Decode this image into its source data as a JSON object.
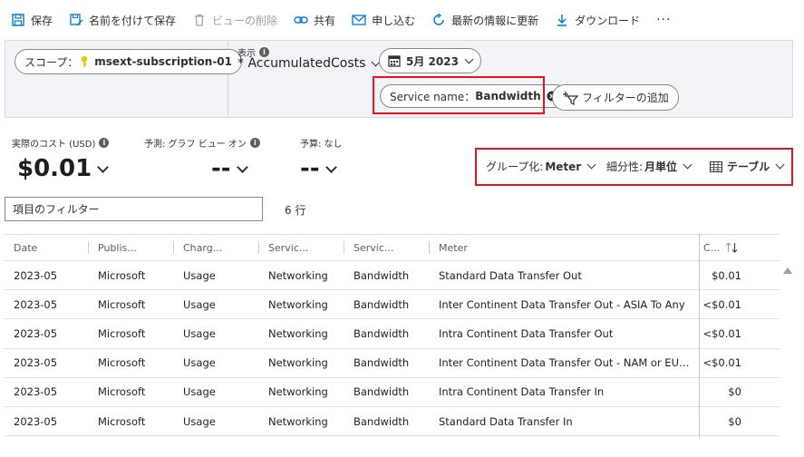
{
  "toolbar": {
    "save": "保存",
    "save_as": "名前を付けて保存",
    "delete_view": "ビューの削除",
    "share": "共有",
    "subscribe": "申し込む",
    "refresh": "最新の情報に更新",
    "download": "ダウンロード",
    "more": "···"
  },
  "filters": {
    "scope_label": "スコープ：",
    "scope_value": "msext-subscription-01",
    "view_label": "表示",
    "view_name": "* AccumulatedCosts",
    "date_range": "5月 2023",
    "service_filter_label": "Service name：",
    "service_filter_value": "Bandwidth",
    "add_filter": "フィルターの追加"
  },
  "kpis": {
    "actual_label": "実際のコスト (USD)",
    "actual_value": "$0.01",
    "forecast_label": "予測: グラフ ビュー オン",
    "forecast_value": "--",
    "budget_label": "予算: なし",
    "budget_value": "--"
  },
  "grouping": {
    "group_label": "グループ化:",
    "group_value": "Meter",
    "granularity_label": "細分性:",
    "granularity_value": "月単位",
    "view_type": "テーブル"
  },
  "table": {
    "filter_placeholder": "項目のフィルター",
    "row_count": "6 行",
    "columns": [
      "Date",
      "Publis...",
      "Charg...",
      "Servic...",
      "Servic...",
      "Meter",
      "C..."
    ],
    "rows": [
      [
        "2023-05",
        "Microsoft",
        "Usage",
        "Networking",
        "Bandwidth",
        "Standard Data Transfer Out",
        "$0.01"
      ],
      [
        "2023-05",
        "Microsoft",
        "Usage",
        "Networking",
        "Bandwidth",
        "Inter Continent Data Transfer Out - ASIA To Any",
        "<$0.01"
      ],
      [
        "2023-05",
        "Microsoft",
        "Usage",
        "Networking",
        "Bandwidth",
        "Intra Continent Data Transfer Out",
        "<$0.01"
      ],
      [
        "2023-05",
        "Microsoft",
        "Usage",
        "Networking",
        "Bandwidth",
        "Inter Continent Data Transfer Out - NAM or EU To ...",
        "<$0.01"
      ],
      [
        "2023-05",
        "Microsoft",
        "Usage",
        "Networking",
        "Bandwidth",
        "Intra Continent Data Transfer In",
        "$0"
      ],
      [
        "2023-05",
        "Microsoft",
        "Usage",
        "Networking",
        "Bandwidth",
        "Standard Data Transfer In",
        "$0"
      ]
    ]
  },
  "colors": {
    "accent": "#0078d4",
    "highlight_box": "#e81123",
    "band_bg": "#f3f4f8",
    "key_icon": "#f2c811"
  }
}
